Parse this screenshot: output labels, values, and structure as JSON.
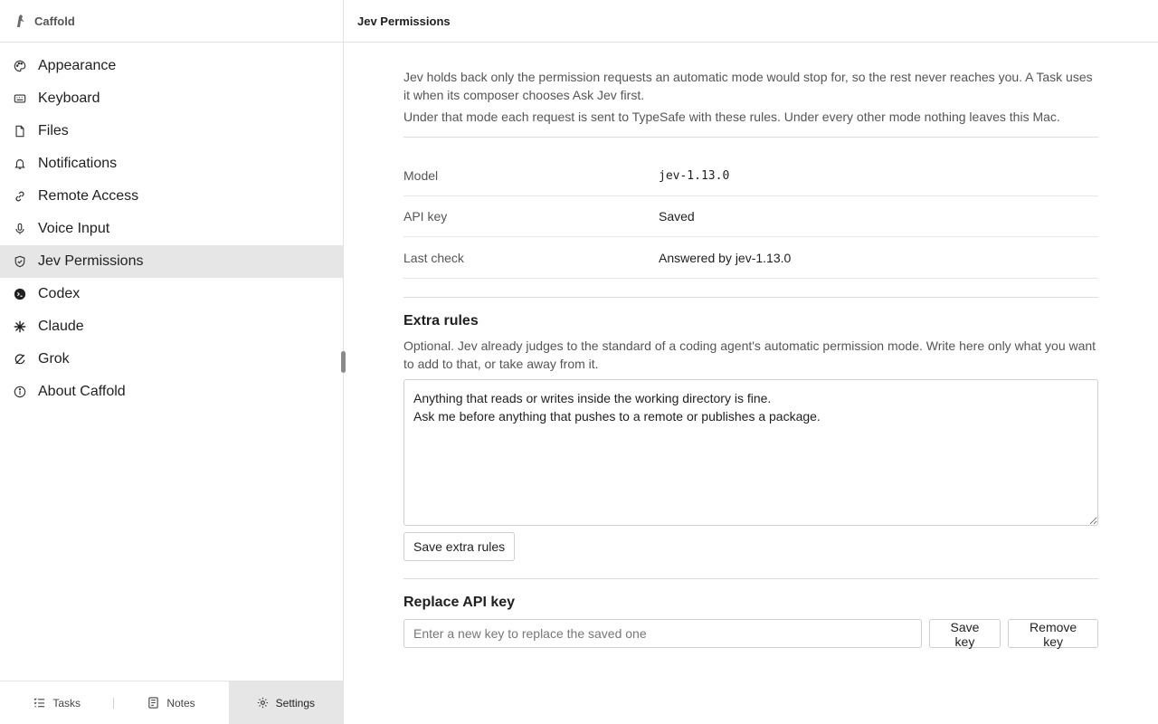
{
  "app": {
    "name": "Caffold"
  },
  "sidebar": {
    "items": [
      {
        "label": "Appearance",
        "icon": "palette-icon"
      },
      {
        "label": "Keyboard",
        "icon": "keyboard-icon"
      },
      {
        "label": "Files",
        "icon": "file-icon"
      },
      {
        "label": "Notifications",
        "icon": "bell-icon"
      },
      {
        "label": "Remote Access",
        "icon": "link-icon"
      },
      {
        "label": "Voice Input",
        "icon": "microphone-icon"
      },
      {
        "label": "Jev Permissions",
        "icon": "shield-check-icon",
        "active": true
      },
      {
        "label": "Codex",
        "icon": "codex-icon"
      },
      {
        "label": "Claude",
        "icon": "claude-icon"
      },
      {
        "label": "Grok",
        "icon": "grok-icon"
      },
      {
        "label": "About Caffold",
        "icon": "info-icon"
      }
    ]
  },
  "bottom_tabs": {
    "tasks": "Tasks",
    "notes": "Notes",
    "settings": "Settings"
  },
  "main": {
    "title": "Jev Permissions",
    "intro_1": "Jev holds back only the permission requests an automatic mode would stop for, so the rest never reaches you. A Task uses it when its composer chooses Ask Jev first.",
    "intro_2": "Under that mode each request is sent to TypeSafe with these rules. Under every other mode nothing leaves this Mac.",
    "details": [
      {
        "key": "Model",
        "value": "jev-1.13.0"
      },
      {
        "key": "API key",
        "value": "Saved"
      },
      {
        "key": "Last check",
        "value": "Answered by jev-1.13.0"
      }
    ],
    "extra_rules": {
      "title": "Extra rules",
      "description": "Optional. Jev already judges to the standard of a coding agent's automatic permission mode. Write here only what you want to add to that, or take away from it.",
      "value": "Anything that reads or writes inside the working directory is fine.\nAsk me before anything that pushes to a remote or publishes a package.",
      "save_label": "Save extra rules"
    },
    "replace_key": {
      "title": "Replace API key",
      "placeholder": "Enter a new key to replace the saved one",
      "save_label": "Save key",
      "remove_label": "Remove key"
    }
  }
}
